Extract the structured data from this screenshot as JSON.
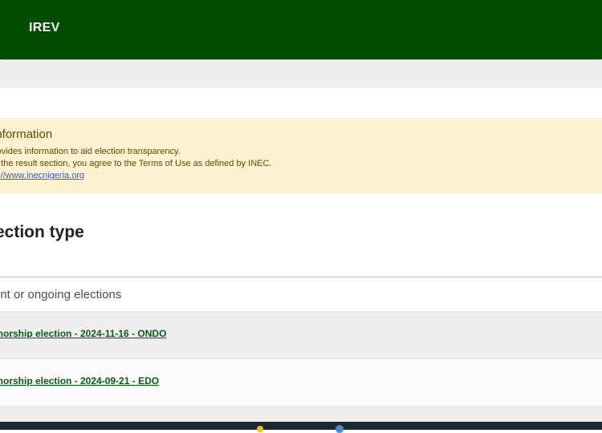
{
  "header": {
    "brand": "IREV"
  },
  "info": {
    "title": "information",
    "line1": "rovides information to aid election transparency.",
    "line2": "o the result section, you agree to the Terms of Use as defined by INEC.",
    "link": "s://www.inecnigeria.org"
  },
  "section": {
    "title": "ection type"
  },
  "elections": {
    "header": "ent or ongoing elections",
    "items": [
      {
        "label": "rnorship election - 2024-11-16 - ONDO"
      },
      {
        "label": "rnorship election - 2024-09-21 - EDO"
      }
    ]
  },
  "colors": {
    "navbar": "#024c01",
    "info_bg": "#fcf2d0",
    "link": "#0b5a16"
  }
}
